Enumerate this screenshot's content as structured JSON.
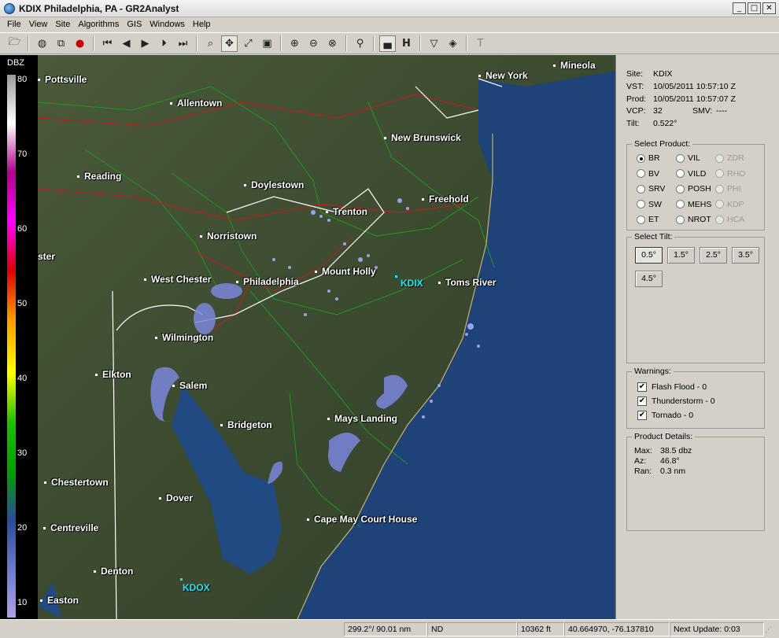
{
  "window": {
    "title": "KDIX Philadelphia, PA - GR2Analyst",
    "minimize": "_",
    "maximize": "□",
    "close": "✕"
  },
  "menu": [
    "File",
    "View",
    "Site",
    "Algorithms",
    "GIS",
    "Windows",
    "Help"
  ],
  "toolbar": {
    "icons": [
      "open-icon",
      "globe-icon",
      "copy-icon",
      "record-icon",
      "first-frame-icon",
      "prev-frame-icon",
      "play-icon",
      "next-frame-icon",
      "last-frame-icon",
      "zoom-icon",
      "pan-icon",
      "measure-icon",
      "layers-icon",
      "zoom-in-icon",
      "zoom-out-icon",
      "zoom-reset-icon",
      "probe-icon",
      "storm-icon",
      "h-icon",
      "tornado-icon",
      "diamond-icon",
      "text-icon"
    ]
  },
  "scale": {
    "unit": "DBZ",
    "ticks": [
      "80",
      "70",
      "60",
      "50",
      "40",
      "30",
      "20",
      "10"
    ],
    "colors": [
      "#9a9a9a",
      "#ffffff",
      "#b0008a",
      "#ff00ff",
      "#d80000",
      "#ff9900",
      "#ffff00",
      "#1ec000",
      "#00a000",
      "#2a4a9a",
      "#6a7ad0",
      "#b0a0e8"
    ]
  },
  "map": {
    "cities": [
      {
        "name": "Pottsville"
      },
      {
        "name": "Allentown"
      },
      {
        "name": "New York"
      },
      {
        "name": "Mineola"
      },
      {
        "name": "New Brunswick"
      },
      {
        "name": "Reading"
      },
      {
        "name": "Doylestown"
      },
      {
        "name": "Trenton"
      },
      {
        "name": "Freehold"
      },
      {
        "name": "Norristown"
      },
      {
        "name": "ster"
      },
      {
        "name": "West Chester"
      },
      {
        "name": "Philadelphia"
      },
      {
        "name": "Mount Holly"
      },
      {
        "name": "Toms River"
      },
      {
        "name": "Wilmington"
      },
      {
        "name": "Elkton"
      },
      {
        "name": "Salem"
      },
      {
        "name": "Bridgeton"
      },
      {
        "name": "Mays Landing"
      },
      {
        "name": "Chestertown"
      },
      {
        "name": "Dover"
      },
      {
        "name": "Cape May Court House"
      },
      {
        "name": "Centreville"
      },
      {
        "name": "Denton"
      },
      {
        "name": "Easton"
      }
    ],
    "sites": [
      {
        "name": "KDIX"
      },
      {
        "name": "KDOX"
      }
    ]
  },
  "info": {
    "site_label": "Site:",
    "site": "KDIX",
    "vst_label": "VST:",
    "vst": "10/05/2011  10:57:10 Z",
    "prod_label": "Prod:",
    "prod": "10/05/2011  10:57:07 Z",
    "vcp_label": "VCP:",
    "vcp": "32",
    "smv_label": "SMV:",
    "smv": "----",
    "tilt_label": "Tilt:",
    "tilt": "0.522°"
  },
  "product": {
    "title": "Select Product:",
    "options": [
      {
        "label": "BR",
        "selected": true,
        "enabled": true
      },
      {
        "label": "VIL",
        "selected": false,
        "enabled": true
      },
      {
        "label": "ZDR",
        "selected": false,
        "enabled": false
      },
      {
        "label": "BV",
        "selected": false,
        "enabled": true
      },
      {
        "label": "VILD",
        "selected": false,
        "enabled": true
      },
      {
        "label": "RHO",
        "selected": false,
        "enabled": false
      },
      {
        "label": "SRV",
        "selected": false,
        "enabled": true
      },
      {
        "label": "POSH",
        "selected": false,
        "enabled": true
      },
      {
        "label": "PHI",
        "selected": false,
        "enabled": false
      },
      {
        "label": "SW",
        "selected": false,
        "enabled": true
      },
      {
        "label": "MEHS",
        "selected": false,
        "enabled": true
      },
      {
        "label": "KDP",
        "selected": false,
        "enabled": false
      },
      {
        "label": "ET",
        "selected": false,
        "enabled": true
      },
      {
        "label": "NROT",
        "selected": false,
        "enabled": true
      },
      {
        "label": "HCA",
        "selected": false,
        "enabled": false
      }
    ]
  },
  "tilt": {
    "title": "Select Tilt:",
    "options": [
      "0.5°",
      "1.5°",
      "2.5°",
      "3.5°",
      "4.5°"
    ],
    "selected": "0.5°"
  },
  "warnings": {
    "title": "Warnings:",
    "items": [
      {
        "label": "Flash Flood - 0",
        "checked": true
      },
      {
        "label": "Thunderstorm - 0",
        "checked": true
      },
      {
        "label": "Tornado - 0",
        "checked": true
      }
    ]
  },
  "details": {
    "title": "Product Details:",
    "max_label": "Max:",
    "max": "38.5 dbz",
    "az_label": "Az:",
    "az": "46.8°",
    "ran_label": "Ran:",
    "ran": "0.3 nm"
  },
  "status": {
    "bearing": "299.2°/ 90.01 nm",
    "value": "ND",
    "height": "10362 ft",
    "coords": "40.664970, -76.137810",
    "next_update": "Next Update: 0:03"
  }
}
